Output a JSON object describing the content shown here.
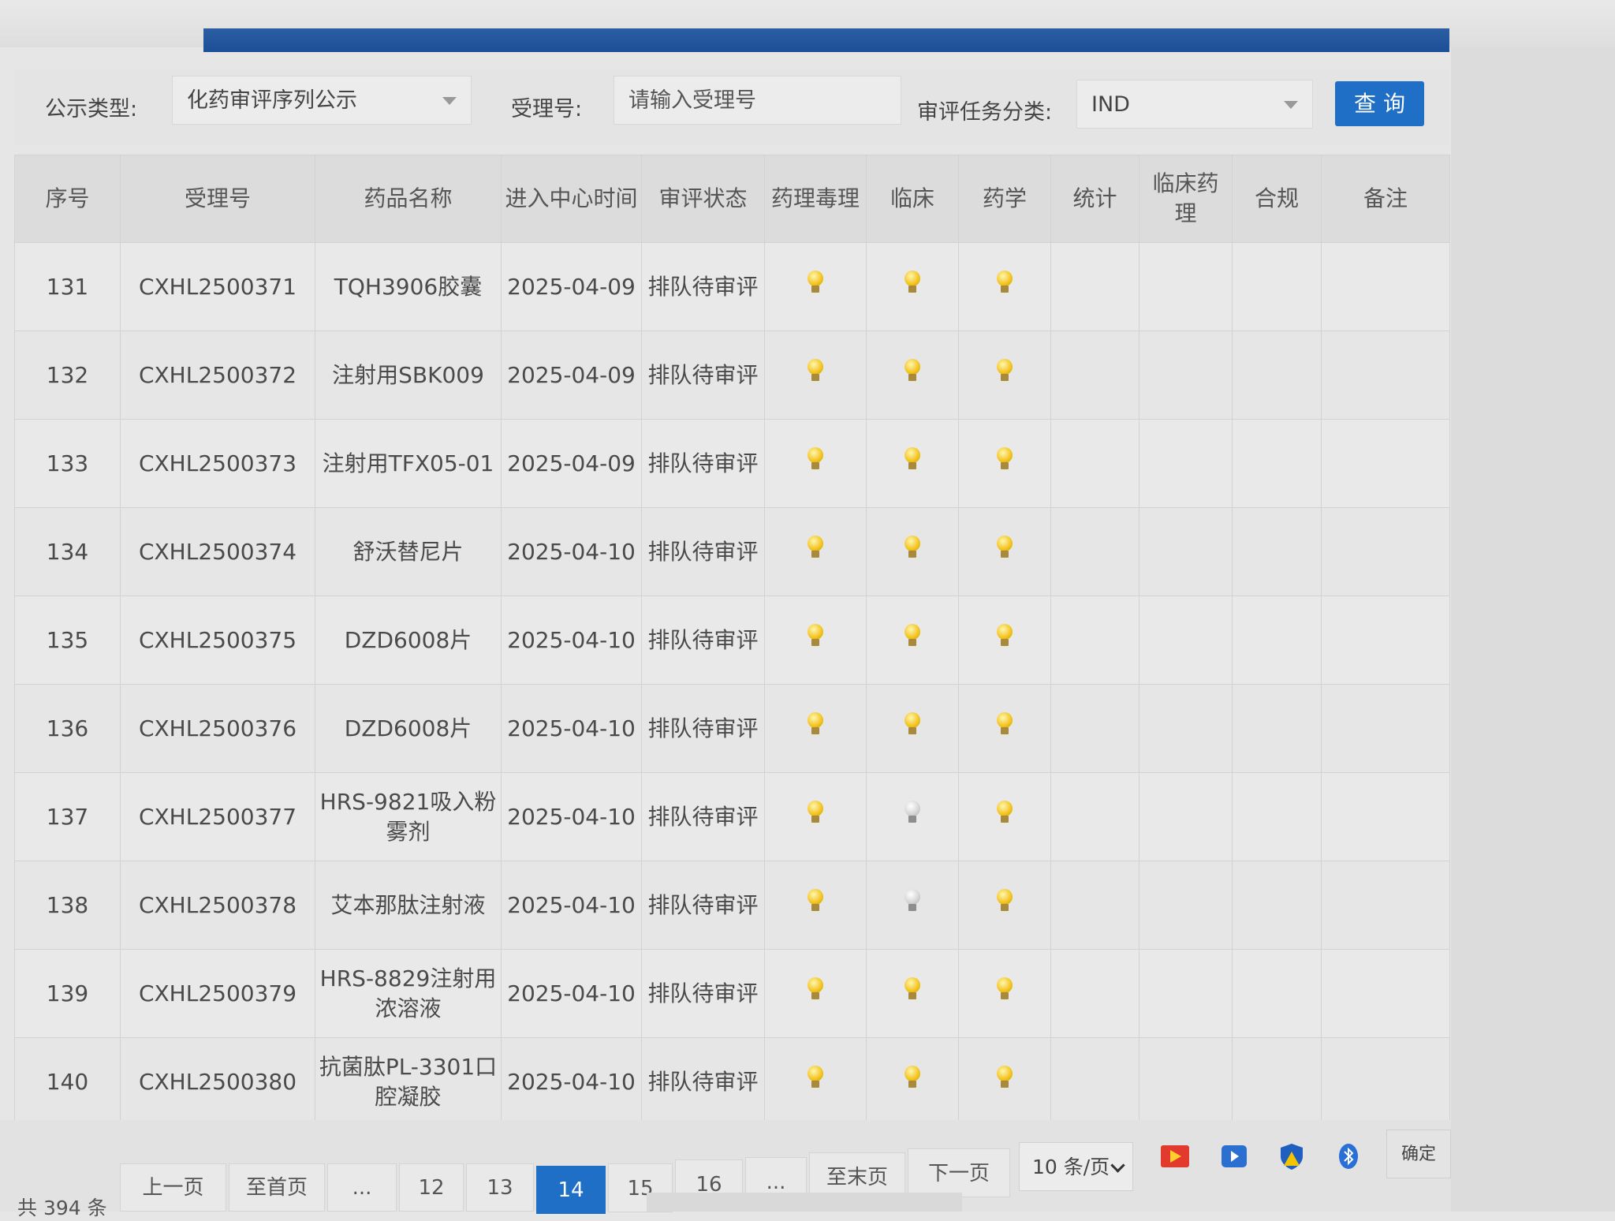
{
  "filters": {
    "type_label": "公示类型:",
    "type_value": "化药审评序列公示",
    "accept_label": "受理号:",
    "accept_placeholder": "请输入受理号",
    "task_label": "审评任务分类:",
    "task_value": "IND",
    "query_button": "查 询"
  },
  "table": {
    "headers": [
      "序号",
      "受理号",
      "药品名称",
      "进入中心时间",
      "审评状态",
      "药理毒理",
      "临床",
      "药学",
      "统计",
      "临床药理",
      "合规",
      "备注"
    ],
    "rows": [
      {
        "no": "131",
        "id": "CXHL2500371",
        "name": "TQH3906胶囊",
        "date": "2025-04-09",
        "status": "排队待审评",
        "tox": "on",
        "clin": "on",
        "pharm": "on"
      },
      {
        "no": "132",
        "id": "CXHL2500372",
        "name": "注射用SBK009",
        "date": "2025-04-09",
        "status": "排队待审评",
        "tox": "on",
        "clin": "on",
        "pharm": "on"
      },
      {
        "no": "133",
        "id": "CXHL2500373",
        "name": "注射用TFX05-01",
        "date": "2025-04-09",
        "status": "排队待审评",
        "tox": "on",
        "clin": "on",
        "pharm": "on"
      },
      {
        "no": "134",
        "id": "CXHL2500374",
        "name": "舒沃替尼片",
        "date": "2025-04-10",
        "status": "排队待审评",
        "tox": "on",
        "clin": "on",
        "pharm": "on"
      },
      {
        "no": "135",
        "id": "CXHL2500375",
        "name": "DZD6008片",
        "date": "2025-04-10",
        "status": "排队待审评",
        "tox": "on",
        "clin": "on",
        "pharm": "on"
      },
      {
        "no": "136",
        "id": "CXHL2500376",
        "name": "DZD6008片",
        "date": "2025-04-10",
        "status": "排队待审评",
        "tox": "on",
        "clin": "on",
        "pharm": "on"
      },
      {
        "no": "137",
        "id": "CXHL2500377",
        "name": "HRS-9821吸入粉雾剂",
        "date": "2025-04-10",
        "status": "排队待审评",
        "tox": "on",
        "clin": "off",
        "pharm": "on"
      },
      {
        "no": "138",
        "id": "CXHL2500378",
        "name": "艾本那肽注射液",
        "date": "2025-04-10",
        "status": "排队待审评",
        "tox": "on",
        "clin": "off",
        "pharm": "on"
      },
      {
        "no": "139",
        "id": "CXHL2500379",
        "name": "HRS-8829注射用浓溶液",
        "date": "2025-04-10",
        "status": "排队待审评",
        "tox": "on",
        "clin": "on",
        "pharm": "on"
      },
      {
        "no": "140",
        "id": "CXHL2500380",
        "name": "抗菌肽PL-3301口腔凝胶",
        "date": "2025-04-10",
        "status": "排队待审评",
        "tox": "on",
        "clin": "on",
        "pharm": "on"
      }
    ]
  },
  "pager": {
    "total": "共 394 条",
    "prev": "上一页",
    "first": "至首页",
    "ellipsis": "...",
    "pages": [
      "12",
      "13",
      "14",
      "15",
      "16"
    ],
    "current": "14",
    "last": "至末页",
    "next": "下一页",
    "page_size": "10 条/页",
    "confirm": "确定"
  },
  "colors": {
    "accent": "#1f6fc6",
    "bulb_on": "#f2c21b",
    "bulb_off": "#cfcfcf"
  }
}
